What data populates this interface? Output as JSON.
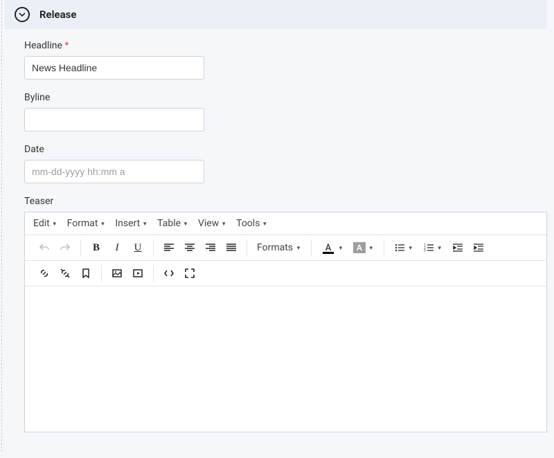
{
  "section": {
    "title": "Release"
  },
  "fields": {
    "headline": {
      "label": "Headline",
      "required": "*",
      "value": "News Headline"
    },
    "byline": {
      "label": "Byline",
      "value": ""
    },
    "date": {
      "label": "Date",
      "placeholder": "mm-dd-yyyy hh:mm a",
      "value": ""
    },
    "teaser": {
      "label": "Teaser"
    }
  },
  "editor": {
    "menu": {
      "edit": "Edit",
      "format": "Format",
      "insert": "Insert",
      "table": "Table",
      "view": "View",
      "tools": "Tools"
    },
    "formats_label": "Formats"
  }
}
